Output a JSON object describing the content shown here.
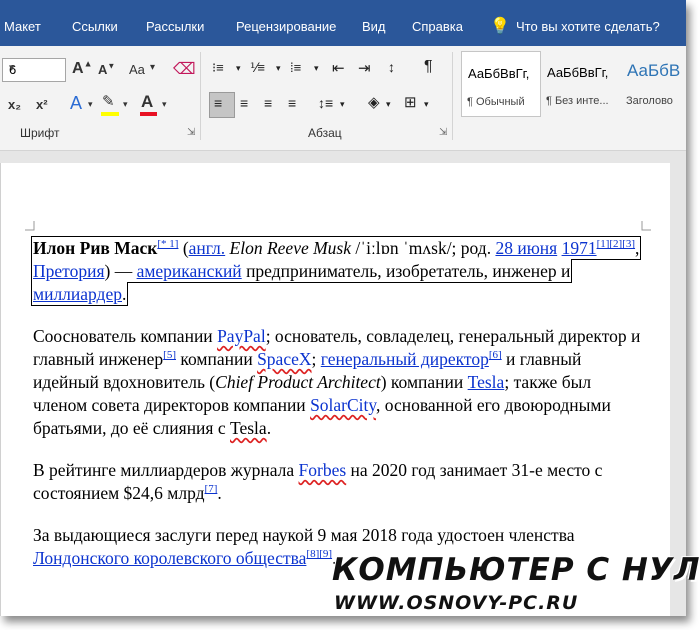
{
  "tabs": {
    "maket": "Макет",
    "links": "Ссылки",
    "mailings": "Рассылки",
    "review": "Рецензирование",
    "view": "Вид",
    "help": "Справка",
    "tell_me": "Что вы хотите сделать?"
  },
  "ribbon": {
    "font_size": "6",
    "font_group_label": "Шрифт",
    "paragraph_group_label": "Абзац",
    "change_case": "Aa",
    "subscript": "x₂",
    "superscript": "x²",
    "styles": [
      {
        "preview": "АаБбВвГг,",
        "name": "¶ Обычный"
      },
      {
        "preview": "АаБбВвГг,",
        "name": "¶ Без инте..."
      },
      {
        "preview": "АаБбВ",
        "name": "Заголово"
      }
    ]
  },
  "document": {
    "p1": {
      "name_bold": "Илон Рив Маск",
      "note": "[* 1]",
      "t1": " (",
      "angl": "англ.",
      "t2": " ",
      "name_en": "Elon Reeve Musk",
      "t3": " /ˈiːlɒn ˈmʌsk/; род. ",
      "date_day": "28 июня",
      "t4": " ",
      "year": "1971",
      "refs": "[1][2][3]",
      "t5": ", ",
      "city": "Претория",
      "t6": ") — ",
      "american": "американский",
      "t7": " предприниматель, изобретатель, инженер и ",
      "billionaire": "миллиардер",
      "t8": "."
    },
    "p2": {
      "t1": "Сооснователь компании ",
      "paypal": "PayPal",
      "t2": "; основатель, совладелец, генеральный директор и главный инженер",
      "ref5": "[5]",
      "t3": " компании ",
      "spacex": "SpaceX",
      "t4": "; ",
      "ceo": "генеральный директор",
      "ref6": "[6]",
      "t5": " и главный идейный вдохновитель (",
      "cpa": "Chief Product Architect",
      "t6": ") компании ",
      "tesla": "Tesla",
      "t7": "; также был членом совета директоров компании ",
      "solarcity": "SolarCity",
      "t8": ", основанной его двоюродными братьями, до её слияния с ",
      "tesla2": "Tesla",
      "t9": "."
    },
    "p3": {
      "t1": "В рейтинге миллиардеров журнала ",
      "forbes": "Forbes",
      "t2": " на 2020 год занимает 31-е место с состоянием $24,6 млрд",
      "ref7": "[7]",
      "t3": "."
    },
    "p4": {
      "t1": "За выдающиеся заслуги перед наукой 9 мая 2018 года удостоен членства ",
      "royal": "Лондонского королевского общества",
      "ref89": "[8][9]",
      "t2": "."
    }
  },
  "watermark": {
    "line1": "КОМПЬЮТЕР С НУЛЯ",
    "line2": "WWW.OSNOVY-PC.RU"
  },
  "colors": {
    "ribbon_tab_bar": "#2b579a",
    "link": "#0b33cf",
    "highlight": "#ffff00",
    "font_color": "#e81123"
  }
}
